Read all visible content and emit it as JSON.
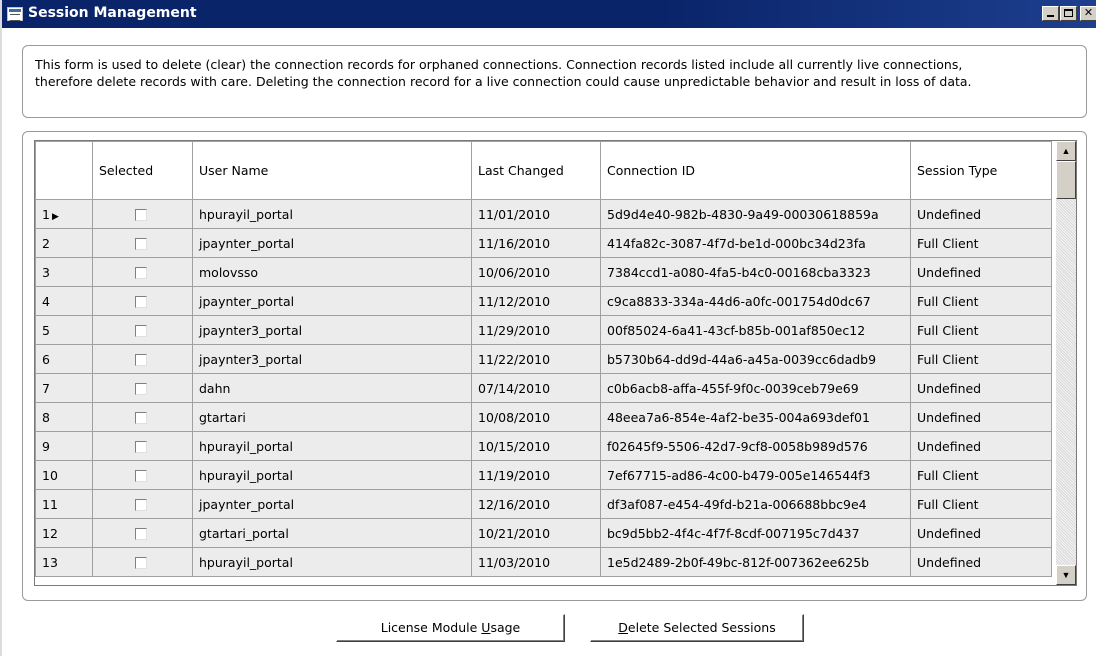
{
  "window": {
    "title": "Session Management",
    "minimize_label": "_",
    "maximize_label": "□",
    "close_label": "✕"
  },
  "info": {
    "text_line1": "This form is used to delete (clear) the connection records for orphaned connections. Connection records listed include all currently live connections,",
    "text_line2": "therefore delete records with care. Deleting the connection record for a live connection could cause unpredictable behavior and result in loss of data."
  },
  "grid": {
    "columns": [
      "",
      "Selected",
      "User Name",
      "Last Changed",
      "Connection ID",
      "Session Type"
    ],
    "current_row_marker": "▶",
    "rows": [
      {
        "num": "1",
        "selected": false,
        "user": "hpurayil_portal",
        "changed": "11/01/2010",
        "conn": "5d9d4e40-982b-4830-9a49-00030618859a",
        "type": "Undefined"
      },
      {
        "num": "2",
        "selected": false,
        "user": "jpaynter_portal",
        "changed": "11/16/2010",
        "conn": "414fa82c-3087-4f7d-be1d-000bc34d23fa",
        "type": "Full Client"
      },
      {
        "num": "3",
        "selected": false,
        "user": "molovsso",
        "changed": "10/06/2010",
        "conn": "7384ccd1-a080-4fa5-b4c0-00168cba3323",
        "type": "Undefined"
      },
      {
        "num": "4",
        "selected": false,
        "user": "jpaynter_portal",
        "changed": "11/12/2010",
        "conn": "c9ca8833-334a-44d6-a0fc-001754d0dc67",
        "type": "Full Client"
      },
      {
        "num": "5",
        "selected": false,
        "user": "jpaynter3_portal",
        "changed": "11/29/2010",
        "conn": "00f85024-6a41-43cf-b85b-001af850ec12",
        "type": "Full Client"
      },
      {
        "num": "6",
        "selected": false,
        "user": "jpaynter3_portal",
        "changed": "11/22/2010",
        "conn": "b5730b64-dd9d-44a6-a45a-0039cc6dadb9",
        "type": "Full Client"
      },
      {
        "num": "7",
        "selected": false,
        "user": "dahn",
        "changed": "07/14/2010",
        "conn": "c0b6acb8-affa-455f-9f0c-0039ceb79e69",
        "type": "Undefined"
      },
      {
        "num": "8",
        "selected": false,
        "user": "gtartari",
        "changed": "10/08/2010",
        "conn": "48eea7a6-854e-4af2-be35-004a693def01",
        "type": "Undefined"
      },
      {
        "num": "9",
        "selected": false,
        "user": "hpurayil_portal",
        "changed": "10/15/2010",
        "conn": "f02645f9-5506-42d7-9cf8-0058b989d576",
        "type": "Undefined"
      },
      {
        "num": "10",
        "selected": false,
        "user": "hpurayil_portal",
        "changed": "11/19/2010",
        "conn": "7ef67715-ad86-4c00-b479-005e146544f3",
        "type": "Full Client"
      },
      {
        "num": "11",
        "selected": false,
        "user": "jpaynter_portal",
        "changed": "12/16/2010",
        "conn": "df3af087-e454-49fd-b21a-006688bbc9e4",
        "type": "Full Client"
      },
      {
        "num": "12",
        "selected": false,
        "user": "gtartari_portal",
        "changed": "10/21/2010",
        "conn": "bc9d5bb2-4f4c-4f7f-8cdf-007195c7d437",
        "type": "Undefined"
      },
      {
        "num": "13",
        "selected": false,
        "user": "hpurayil_portal",
        "changed": "11/03/2010",
        "conn": "1e5d2489-2b0f-49bc-812f-007362ee625b",
        "type": "Undefined"
      }
    ]
  },
  "buttons": {
    "license_pre": "License Module ",
    "license_key": "U",
    "license_post": "sage",
    "delete_key": "D",
    "delete_post": "elete Selected Sessions"
  },
  "icons": {
    "app": "window-app-icon",
    "row_pointer": "current-row-arrow-icon",
    "scroll_up": "scroll-up-arrow-icon",
    "scroll_down": "scroll-down-arrow-icon"
  },
  "colors": {
    "titlebar": "#0a246a",
    "row_background": "#ececec",
    "button_face": "#d4d0c8"
  }
}
